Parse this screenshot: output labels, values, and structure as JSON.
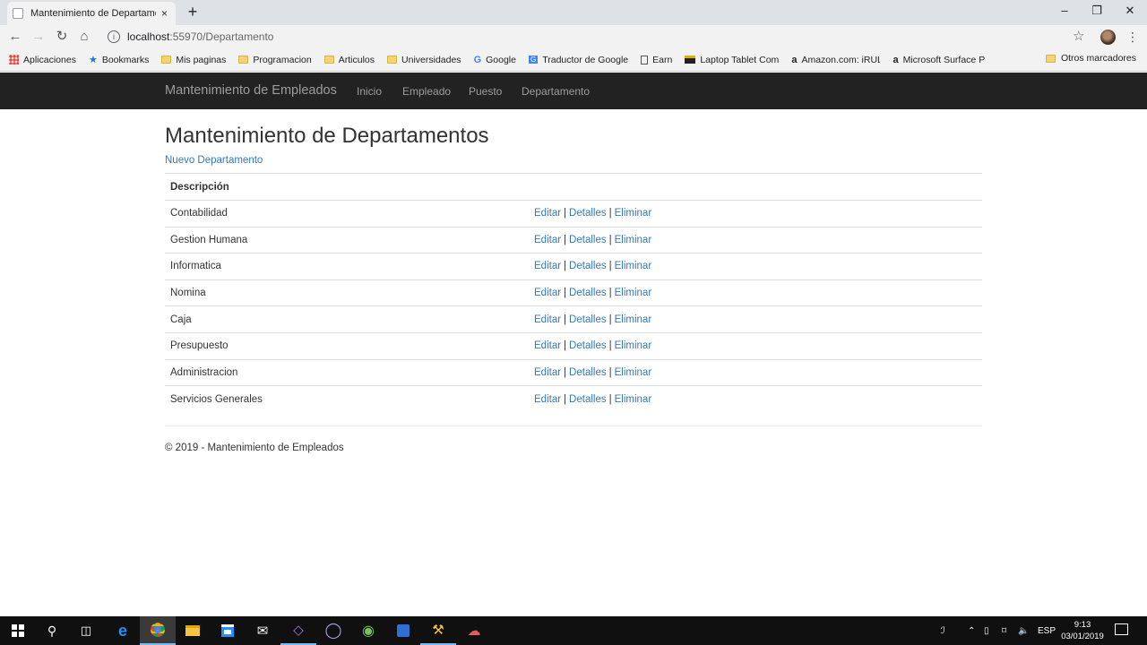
{
  "browser": {
    "tab_title": "Mantenimiento de Departamento",
    "tab_close": "×",
    "new_tab": "+",
    "window_minimize": "–",
    "window_restore": "❐",
    "window_close": "✕",
    "url_host": "localhost",
    "url_path": ":55970/Departamento",
    "bookmarks": [
      {
        "label": "Aplicaciones",
        "icon": "apps-grid-icon"
      },
      {
        "label": "Bookmarks",
        "icon": "star-icon"
      },
      {
        "label": "Mis paginas",
        "icon": "folder-icon"
      },
      {
        "label": "Programacion",
        "icon": "folder-icon"
      },
      {
        "label": "Articulos",
        "icon": "folder-icon"
      },
      {
        "label": "Universidades",
        "icon": "folder-icon"
      },
      {
        "label": "Google",
        "icon": "google-icon"
      },
      {
        "label": "Traductor de Google",
        "icon": "translate-icon"
      },
      {
        "label": "Earn",
        "icon": "page-icon"
      },
      {
        "label": "Laptop Tablet Combo",
        "icon": "store-icon"
      },
      {
        "label": "Amazon.com: iRULU",
        "icon": "amazon-icon"
      },
      {
        "label": "Microsoft Surface Pro",
        "icon": "amazon-icon"
      }
    ],
    "other_bookmarks": "Otros marcadores"
  },
  "navbar": {
    "brand": "Mantenimiento de Empleados",
    "links": [
      "Inicio",
      "Empleado",
      "Puesto",
      "Departamento"
    ]
  },
  "page": {
    "title": "Mantenimiento de Departamentos",
    "new_link": "Nuevo Departamento",
    "table_header": "Descripción",
    "actions": {
      "edit": "Editar",
      "details": "Detalles",
      "delete": "Eliminar",
      "separator": "|"
    },
    "rows": [
      "Contabilidad",
      "Gestion Humana",
      "Informatica",
      "Nomina",
      "Caja",
      "Presupuesto",
      "Administracion",
      "Servicios Generales"
    ],
    "footer": "© 2019 - Mantenimiento de Empleados"
  },
  "taskbar": {
    "language": "ESP",
    "time": "9:13",
    "date": "03/01/2019"
  },
  "colors": {
    "link": "#337ab7",
    "navbar_bg": "#222222",
    "navbar_text": "#9d9d9d"
  }
}
